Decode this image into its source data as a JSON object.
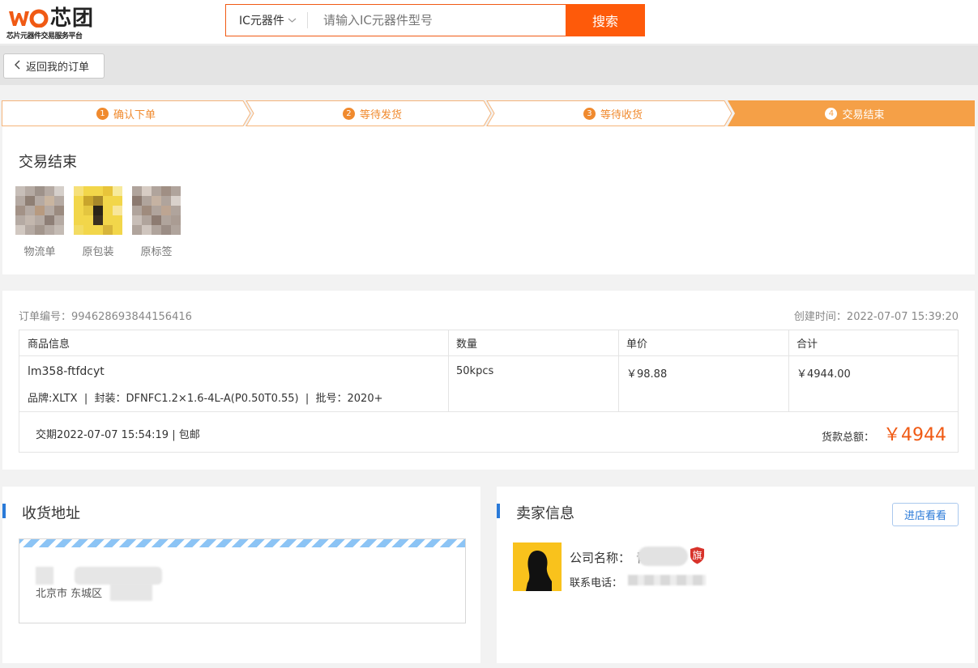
{
  "header": {
    "logo_text": "芯团",
    "logo_sub": "芯片元器件交易服务平台",
    "search_category": "IC元器件",
    "search_placeholder": "请输入IC元器件型号",
    "search_button": "搜索"
  },
  "nav": {
    "back_label": "返回我的订单"
  },
  "steps": [
    {
      "num": "1",
      "label": "确认下单",
      "active": false
    },
    {
      "num": "2",
      "label": "等待发货",
      "active": false
    },
    {
      "num": "3",
      "label": "等待收货",
      "active": false
    },
    {
      "num": "4",
      "label": "交易结束",
      "active": true
    }
  ],
  "status": {
    "title": "交易结束",
    "thumbs": [
      {
        "label": "物流单"
      },
      {
        "label": "原包装"
      },
      {
        "label": "原标签"
      }
    ]
  },
  "order": {
    "number_label": "订单编号：",
    "number": "994628693844156416",
    "created_label": "创建时间：",
    "created": "2022-07-07 15:39:20",
    "headers": [
      "商品信息",
      "数量",
      "单价",
      "合计"
    ],
    "item": {
      "model": "lm358-ftfdcyt",
      "attrs": "品牌:XLTX  |  封装：DFNFC1.2×1.6-4L-A(P0.50T0.55)  |  批号：2020+",
      "quantity": "50kpcs",
      "unit_price": "￥98.88",
      "subtotal": "￥4944.00"
    },
    "delivery": "交期2022-07-07 15:54:19 | 包邮",
    "total_label": "货款总额：",
    "total": "￥4944"
  },
  "address": {
    "title": "收货地址",
    "city": "北京市 东城区"
  },
  "seller": {
    "title": "卖家信息",
    "shop_button": "进店看看",
    "company_label": "公司名称：",
    "company_visible": "青",
    "flag_badge": "旗",
    "phone_label": "联系电话："
  },
  "colors": {
    "accent_orange": "#fe5a0a",
    "step_active": "#f5a047",
    "step_text": "#f08a2e",
    "price_red": "#f05a14",
    "blue": "#2a7ad8"
  }
}
